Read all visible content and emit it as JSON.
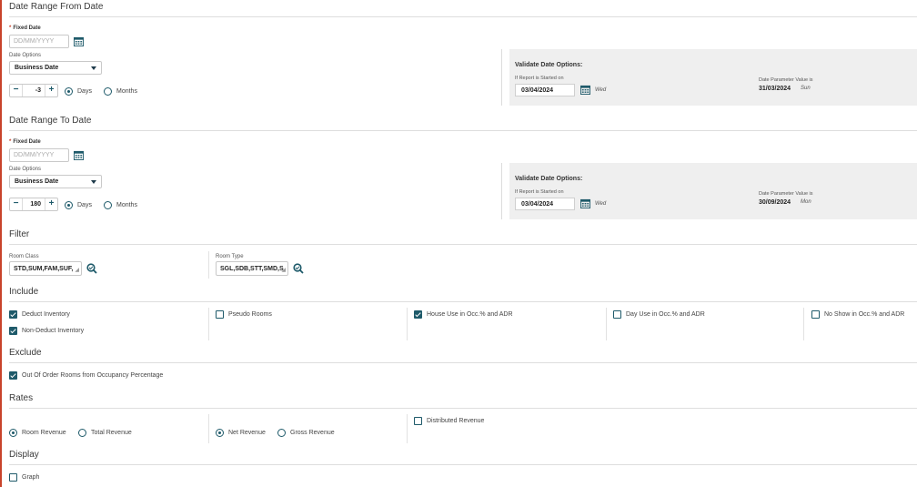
{
  "from": {
    "title": "Date Range From Date",
    "fixed_date_label": "Fixed Date",
    "fixed_date_placeholder": "DD/MM/YYYY",
    "date_options_label": "Date Options",
    "date_option": "Business Date",
    "offset": "-3",
    "unit_days": "Days",
    "unit_months": "Months",
    "validate": {
      "title": "Validate Date Options:",
      "started_on_label": "If Report is Started on",
      "started_on": "03/04/2024",
      "started_day": "Wed",
      "param_label": "Date Parameter Value is",
      "param_value": "31/03/2024",
      "param_day": "Sun"
    }
  },
  "to": {
    "title": "Date Range To Date",
    "fixed_date_label": "Fixed Date",
    "fixed_date_placeholder": "DD/MM/YYYY",
    "date_options_label": "Date Options",
    "date_option": "Business Date",
    "offset": "180",
    "unit_days": "Days",
    "unit_months": "Months",
    "validate": {
      "title": "Validate Date Options:",
      "started_on_label": "If Report is Started on",
      "started_on": "03/04/2024",
      "started_day": "Wed",
      "param_label": "Date Parameter Value is",
      "param_value": "30/09/2024",
      "param_day": "Mon"
    }
  },
  "filter": {
    "title": "Filter",
    "room_class_label": "Room Class",
    "room_class_value": "STD,SUM,FAM,SUF,",
    "room_type_label": "Room Type",
    "room_type_value": "SGL,SDB,STT,SMD,S"
  },
  "include": {
    "title": "Include",
    "items": [
      {
        "label": "Deduct Inventory",
        "checked": true
      },
      {
        "label": "Non-Deduct Inventory",
        "checked": true
      },
      {
        "label": "Pseudo Rooms",
        "checked": false
      },
      {
        "label": "House Use in Occ.% and ADR",
        "checked": true
      },
      {
        "label": "Day Use in Occ.% and ADR",
        "checked": false
      },
      {
        "label": "No Show in Occ.% and ADR",
        "checked": false
      }
    ]
  },
  "exclude": {
    "title": "Exclude",
    "item": "Out Of Order Rooms from Occupancy Percentage"
  },
  "rates": {
    "title": "Rates",
    "room_revenue": "Room Revenue",
    "total_revenue": "Total Revenue",
    "net_revenue": "Net Revenue",
    "gross_revenue": "Gross Revenue",
    "distributed_revenue": "Distributed Revenue"
  },
  "display": {
    "title": "Display",
    "graph": "Graph"
  },
  "colors": {
    "accent": "#1e5a6a",
    "edge": "#c8432b",
    "panel": "#efefef"
  }
}
